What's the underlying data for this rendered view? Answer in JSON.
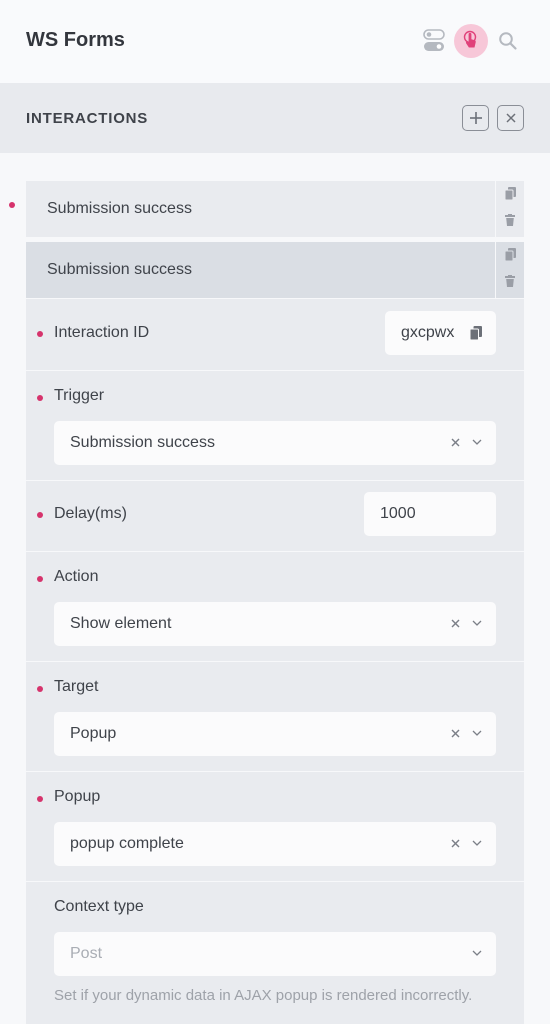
{
  "app": {
    "title": "WS Forms"
  },
  "section": {
    "title": "INTERACTIONS"
  },
  "items": [
    {
      "label": "Submission success"
    },
    {
      "label": "Submission success"
    }
  ],
  "fields": {
    "interaction_id": {
      "label": "Interaction ID",
      "value": "gxcpwx"
    },
    "trigger": {
      "label": "Trigger",
      "value": "Submission success"
    },
    "delay": {
      "label": "Delay(ms)",
      "value": "1000"
    },
    "action": {
      "label": "Action",
      "value": "Show element"
    },
    "target": {
      "label": "Target",
      "value": "Popup"
    },
    "popup": {
      "label": "Popup",
      "value": "popup complete"
    },
    "context_type": {
      "label": "Context type",
      "placeholder": "Post",
      "help": "Set if your dynamic data in AJAX popup is rendered incorrectly."
    }
  },
  "colors": {
    "accent": "#d6336c",
    "accent_light": "#f7c7d8",
    "panel": "#e9ebef",
    "active_item": "#dadee4"
  },
  "icons": [
    "toggle-icon",
    "pointer-icon",
    "search-icon",
    "plus-icon",
    "close-icon",
    "copy-icon",
    "trash-icon",
    "clear-icon",
    "chevron-down-icon"
  ]
}
